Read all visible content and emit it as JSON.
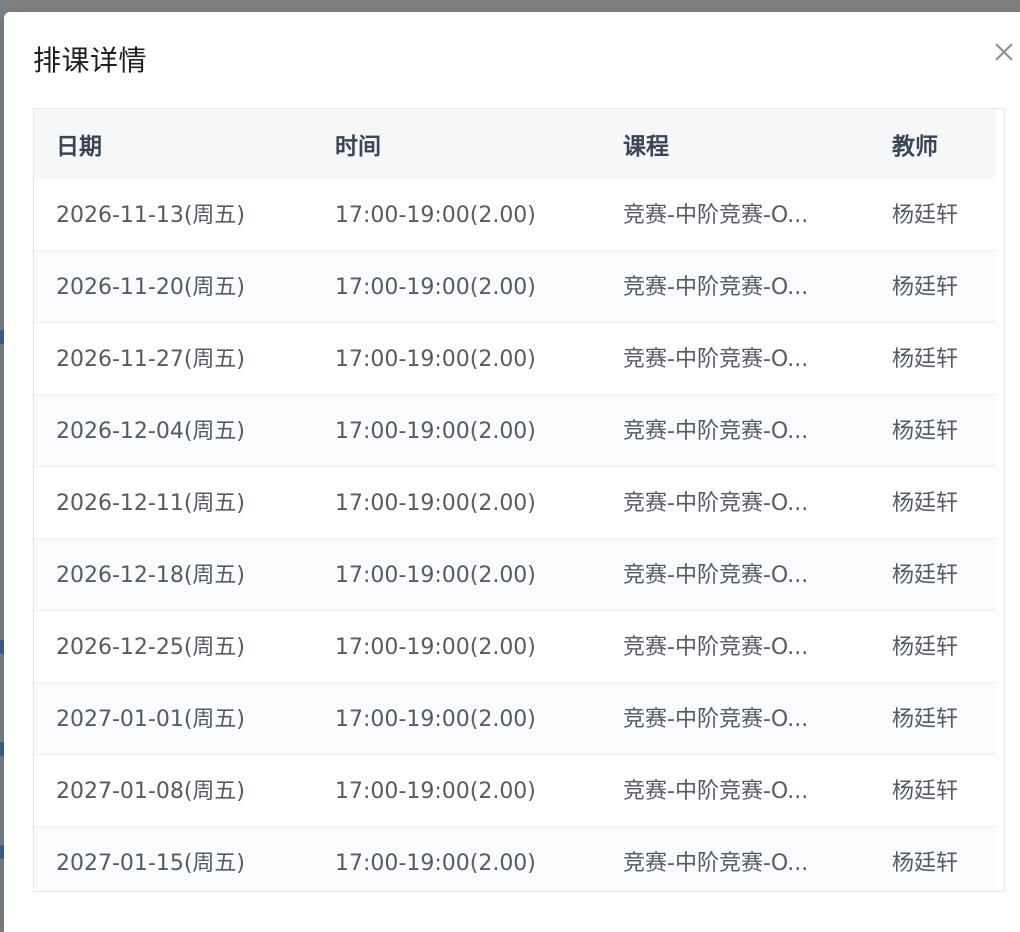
{
  "dialog": {
    "title": "排课详情",
    "close_label": "×"
  },
  "table": {
    "headers": {
      "date": "日期",
      "time": "时间",
      "course": "课程",
      "teacher": "教师"
    },
    "rows": [
      {
        "date": "2026-11-13(周五)",
        "time": "17:00-19:00(2.00)",
        "course": "竞赛-中阶竞赛-O...",
        "teacher": "杨廷轩"
      },
      {
        "date": "2026-11-20(周五)",
        "time": "17:00-19:00(2.00)",
        "course": "竞赛-中阶竞赛-O...",
        "teacher": "杨廷轩"
      },
      {
        "date": "2026-11-27(周五)",
        "time": "17:00-19:00(2.00)",
        "course": "竞赛-中阶竞赛-O...",
        "teacher": "杨廷轩"
      },
      {
        "date": "2026-12-04(周五)",
        "time": "17:00-19:00(2.00)",
        "course": "竞赛-中阶竞赛-O...",
        "teacher": "杨廷轩"
      },
      {
        "date": "2026-12-11(周五)",
        "time": "17:00-19:00(2.00)",
        "course": "竞赛-中阶竞赛-O...",
        "teacher": "杨廷轩"
      },
      {
        "date": "2026-12-18(周五)",
        "time": "17:00-19:00(2.00)",
        "course": "竞赛-中阶竞赛-O...",
        "teacher": "杨廷轩"
      },
      {
        "date": "2026-12-25(周五)",
        "time": "17:00-19:00(2.00)",
        "course": "竞赛-中阶竞赛-O...",
        "teacher": "杨廷轩"
      },
      {
        "date": "2027-01-01(周五)",
        "time": "17:00-19:00(2.00)",
        "course": "竞赛-中阶竞赛-O...",
        "teacher": "杨廷轩"
      },
      {
        "date": "2027-01-08(周五)",
        "time": "17:00-19:00(2.00)",
        "course": "竞赛-中阶竞赛-O...",
        "teacher": "杨廷轩"
      },
      {
        "date": "2027-01-15(周五)",
        "time": "17:00-19:00(2.00)",
        "course": "竞赛-中阶竞赛-O...",
        "teacher": "杨廷轩"
      }
    ]
  },
  "colors": {
    "overlay": "#808080",
    "header_bg": "#f6f7f9",
    "header_text": "#3a4556",
    "cell_text": "#555b64",
    "row_alt_bg": "#fafbfc"
  },
  "icons": {
    "close": "close-icon"
  }
}
